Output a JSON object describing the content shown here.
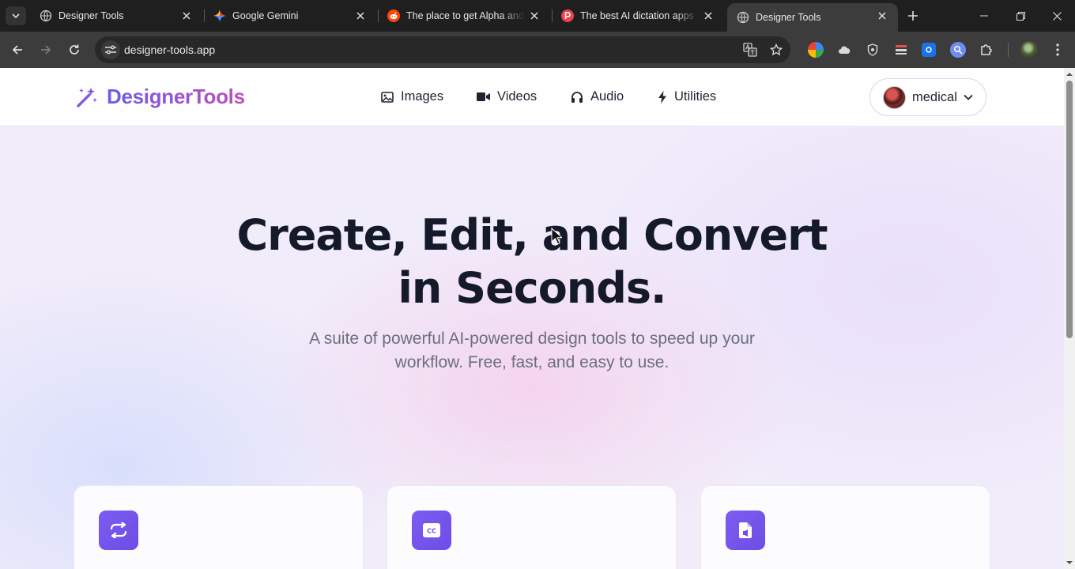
{
  "browser": {
    "tabs": [
      {
        "title": "Designer Tools",
        "favicon": "globe-icon",
        "active": false
      },
      {
        "title": "Google Gemini",
        "favicon": "gemini-icon",
        "active": false
      },
      {
        "title": "The place to get Alpha and D",
        "favicon": "reddit-icon",
        "active": false
      },
      {
        "title": "The best AI dictation apps in",
        "favicon": "p-icon",
        "active": false
      },
      {
        "title": "Designer Tools",
        "favicon": "globe-icon",
        "active": true
      }
    ],
    "url": "designer-tools.app",
    "colors": {
      "chrome_bg": "#1f1f1f",
      "toolbar_bg": "#3c3c3c",
      "omnibox_bg": "#282828"
    }
  },
  "site": {
    "brand": "DesignerTools",
    "nav": [
      {
        "label": "Images",
        "icon": "image-icon"
      },
      {
        "label": "Videos",
        "icon": "video-icon"
      },
      {
        "label": "Audio",
        "icon": "headphones-icon"
      },
      {
        "label": "Utilities",
        "icon": "bolt-icon"
      }
    ],
    "user": {
      "name": "medical"
    },
    "hero": {
      "title_line1": "Create, Edit, and Convert",
      "title_line2": "in Seconds.",
      "subtitle": "A suite of powerful AI-powered design tools to speed up your workflow. Free, fast, and easy to use."
    },
    "cards": [
      {
        "icon": "convert-arrows-icon"
      },
      {
        "icon": "closed-captions-icon"
      },
      {
        "icon": "document-audio-icon"
      }
    ],
    "colors": {
      "brand_start": "#6d5ce8",
      "brand_end": "#c04fb8",
      "accent": "#7656ee",
      "heading": "#151a2b"
    }
  }
}
